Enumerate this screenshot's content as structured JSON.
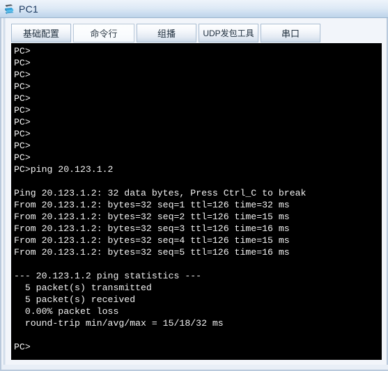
{
  "window": {
    "title": "PC1",
    "icon": "pc-device-icon"
  },
  "tabs": [
    {
      "label": "基础配置",
      "selected": false,
      "name": "tab-basic-config"
    },
    {
      "label": "命令行",
      "selected": true,
      "name": "tab-command-line"
    },
    {
      "label": "组播",
      "selected": false,
      "name": "tab-multicast"
    },
    {
      "label": "UDP发包工具",
      "selected": false,
      "name": "tab-udp-packet-tool"
    },
    {
      "label": "串口",
      "selected": false,
      "name": "tab-serial-port"
    }
  ],
  "terminal": {
    "prompt": "PC>",
    "command": "PC>ping 20.123.1.2",
    "target_ip": "20.123.1.2",
    "lines": [
      "PC>",
      "PC>",
      "PC>",
      "PC>",
      "PC>",
      "PC>",
      "PC>",
      "PC>",
      "PC>",
      "PC>",
      "PC>ping 20.123.1.2",
      "",
      "Ping 20.123.1.2: 32 data bytes, Press Ctrl_C to break",
      "From 20.123.1.2: bytes=32 seq=1 ttl=126 time=32 ms",
      "From 20.123.1.2: bytes=32 seq=2 ttl=126 time=15 ms",
      "From 20.123.1.2: bytes=32 seq=3 ttl=126 time=16 ms",
      "From 20.123.1.2: bytes=32 seq=4 ttl=126 time=15 ms",
      "From 20.123.1.2: bytes=32 seq=5 ttl=126 time=16 ms",
      "",
      "--- 20.123.1.2 ping statistics ---",
      "  5 packet(s) transmitted",
      "  5 packet(s) received",
      "  0.00% packet loss",
      "  round-trip min/avg/max = 15/18/32 ms",
      "",
      "PC>"
    ],
    "statistics": {
      "header": "--- 20.123.1.2 ping statistics ---",
      "transmitted": "  5 packet(s) transmitted",
      "received": "  5 packet(s) received",
      "packet_loss": "  0.00% packet loss",
      "round_trip": "  round-trip min/avg/max = 15/18/32 ms",
      "transmitted_count": 5,
      "received_count": 5,
      "loss_percent": "0.00%",
      "rtt_min": 15,
      "rtt_avg": 18,
      "rtt_max": 32
    },
    "replies": [
      {
        "seq": 1,
        "bytes": 32,
        "ttl": 126,
        "time_ms": 32
      },
      {
        "seq": 2,
        "bytes": 32,
        "ttl": 126,
        "time_ms": 15
      },
      {
        "seq": 3,
        "bytes": 32,
        "ttl": 126,
        "time_ms": 16
      },
      {
        "seq": 4,
        "bytes": 32,
        "ttl": 126,
        "time_ms": 15
      },
      {
        "seq": 5,
        "bytes": 32,
        "ttl": 126,
        "time_ms": 16
      }
    ]
  },
  "colors": {
    "titlebar_top": "#eef4fb",
    "titlebar_bottom": "#bdd3e9",
    "title_text": "#17355c",
    "terminal_bg": "#000000",
    "terminal_fg": "#f2f2f2",
    "frame": "#b9c9dc"
  }
}
